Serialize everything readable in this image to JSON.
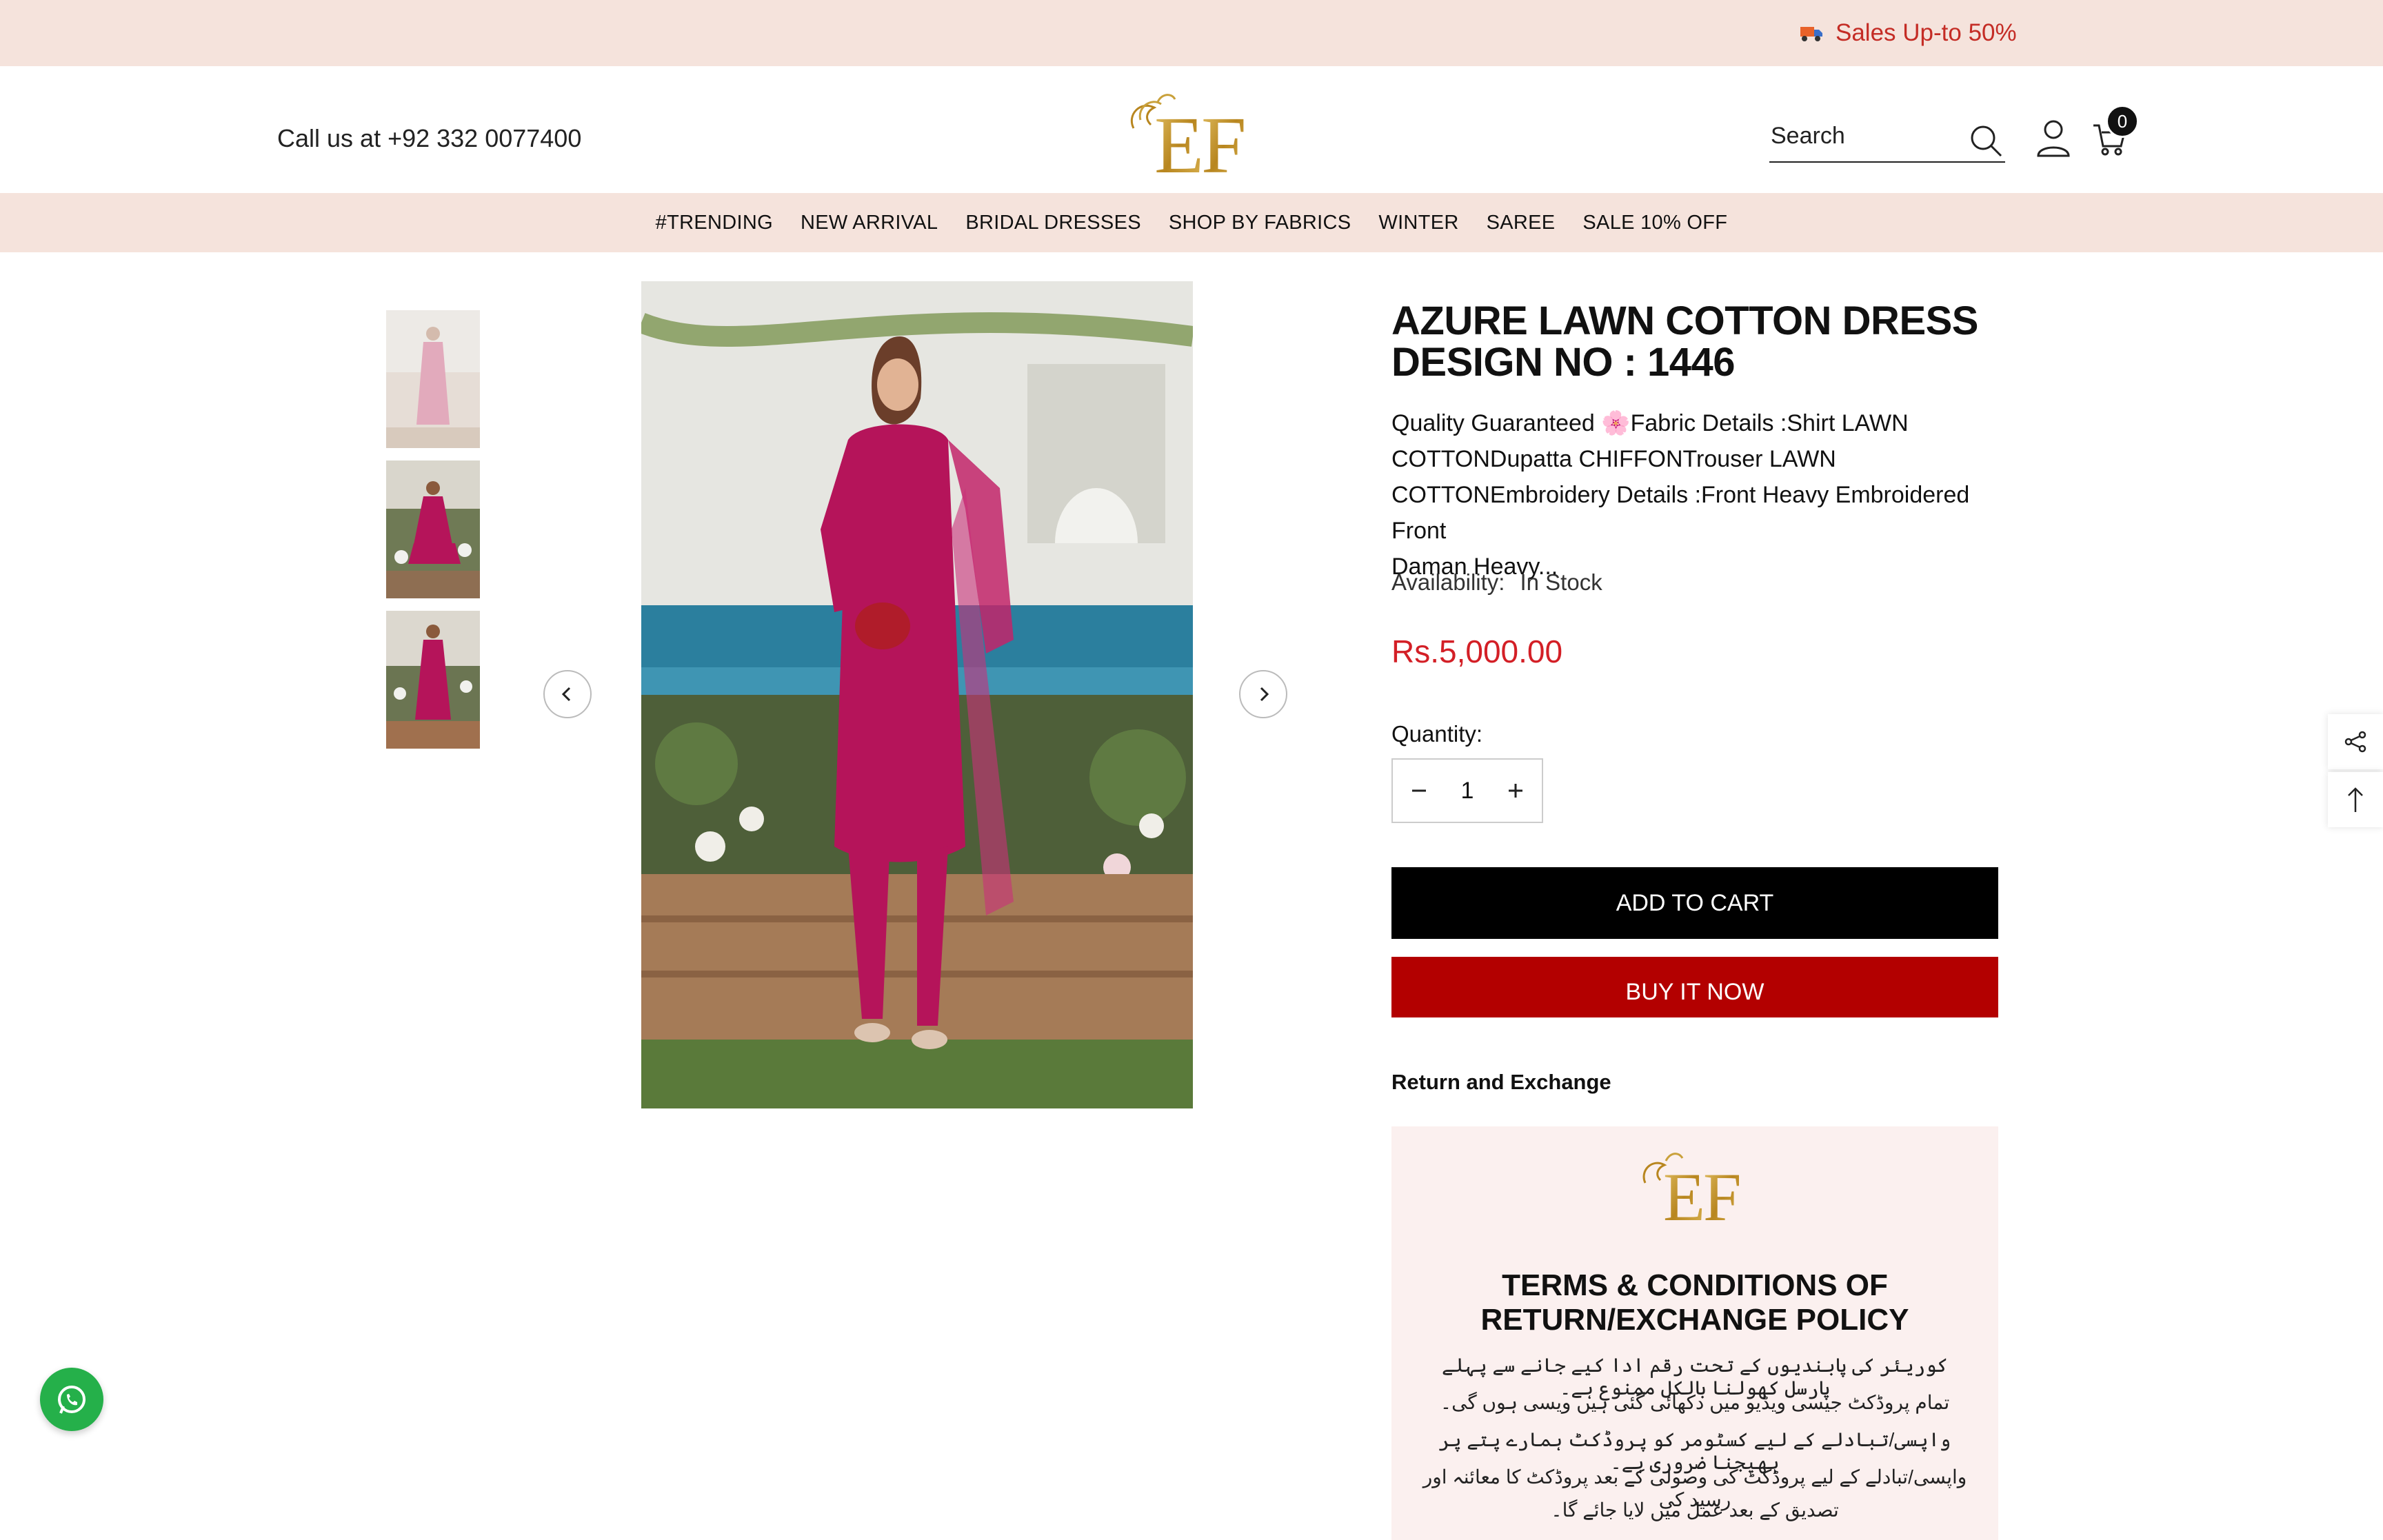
{
  "announcement": {
    "text": "Sales Up-to 50%",
    "icon": "truck-icon"
  },
  "header": {
    "phone_text": "Call us at +92 332 0077400",
    "logo_text": "EF",
    "search_placeholder": "Search",
    "cart_count": "0"
  },
  "nav": {
    "items": [
      "#TRENDING",
      "NEW ARRIVAL",
      "BRIDAL DRESSES",
      "SHOP BY FABRICS",
      "WINTER",
      "SAREE",
      "SALE 10% OFF"
    ]
  },
  "product": {
    "title_line1": "AZURE LAWN COTTON DRESS",
    "title_line2": "DESIGN NO : 1446",
    "description_line1": "Quality Guaranteed 🌸Fabric Details :Shirt LAWN",
    "description_line2": "COTTONDupatta CHIFFONTrouser LAWN",
    "description_line3": "COTTONEmbroidery Details :Front Heavy Embroidered Front",
    "description_line4": "Daman Heavy...",
    "availability_label": "Availability:",
    "availability_value": "In Stock",
    "price": "Rs.5,000.00",
    "quantity_label": "Quantity:",
    "quantity_value": "1",
    "add_to_cart_label": "ADD TO CART",
    "buy_now_label": "BUY IT NOW",
    "return_heading": "Return and Exchange"
  },
  "policy": {
    "heading_line1": "TERMS & CONDITIONS OF",
    "heading_line2": "RETURN/EXCHANGE POLICY",
    "lines": [
      "کوریئر کی پابندیوں کے تحت رقم ادا کیے جانے سے پہلے پارسل کھولنا بالکل ممنوع ہے۔",
      "تمام پروڈکٹ جیسی ویڈیو میں دکھائی گئی ہیں ویسی ہوں گی۔",
      "واپسی/تبادلے کے لیے کسٹومر کو پروڈکٹ ہمارے پتے پر بھیجنا ضروری ہے۔",
      "واپسی/تبادلے کے لیے پروڈکٹ کی وصولی کے بعد پروڈکٹ کا معائنہ اور رسید کی",
      "تصدیق کے بعد عمل میں لایا جائے گا۔"
    ]
  },
  "colors": {
    "announcement_bg": "#f5e3dc",
    "accent_red": "#d31f26",
    "buy_now_bg": "#b30000",
    "gold": "#c9a13b",
    "dress_magenta": "#b5145a"
  }
}
